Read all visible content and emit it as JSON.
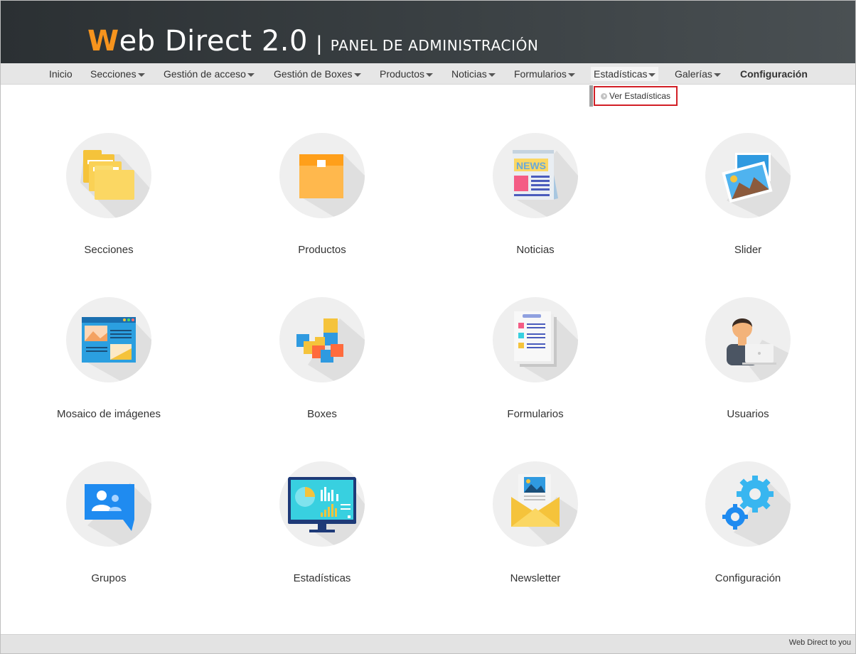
{
  "header": {
    "logo_w": "W",
    "logo_rest": "eb Direct 2.0",
    "separator": "|",
    "subtitle": "PANEL DE ADMINISTRACIÓN",
    "accent_color": "#f7941d",
    "background": "#2f3437"
  },
  "nav": {
    "items": [
      {
        "label": "Inicio",
        "has_dropdown": false
      },
      {
        "label": "Secciones",
        "has_dropdown": true
      },
      {
        "label": "Gestión de acceso",
        "has_dropdown": true
      },
      {
        "label": "Gestión de Boxes",
        "has_dropdown": true
      },
      {
        "label": "Productos",
        "has_dropdown": true
      },
      {
        "label": "Noticias",
        "has_dropdown": true
      },
      {
        "label": "Formularios",
        "has_dropdown": true
      },
      {
        "label": "Estadísticas",
        "has_dropdown": true,
        "active": true
      },
      {
        "label": "Galerías",
        "has_dropdown": true
      },
      {
        "label": "Configuración",
        "has_dropdown": false,
        "bold": true
      }
    ],
    "dropdown": {
      "items": [
        {
          "label": "Ver Estadísticas",
          "highlighted": true
        }
      ],
      "highlight_color": "#d21f26"
    }
  },
  "dashboard": {
    "tiles": [
      {
        "label": "Secciones",
        "icon": "folders-icon"
      },
      {
        "label": "Productos",
        "icon": "box-icon"
      },
      {
        "label": "Noticias",
        "icon": "newspaper-icon"
      },
      {
        "label": "Slider",
        "icon": "images-icon"
      },
      {
        "label": "Mosaico de imágenes",
        "icon": "mosaic-browser-icon"
      },
      {
        "label": "Boxes",
        "icon": "cubes-icon"
      },
      {
        "label": "Formularios",
        "icon": "form-icon"
      },
      {
        "label": "Usuarios",
        "icon": "user-laptop-icon"
      },
      {
        "label": "Grupos",
        "icon": "group-chat-icon"
      },
      {
        "label": "Estadísticas",
        "icon": "monitor-chart-icon"
      },
      {
        "label": "Newsletter",
        "icon": "envelope-icon"
      },
      {
        "label": "Configuración",
        "icon": "gears-icon"
      }
    ]
  },
  "footer": {
    "text": "Web Direct to you"
  }
}
